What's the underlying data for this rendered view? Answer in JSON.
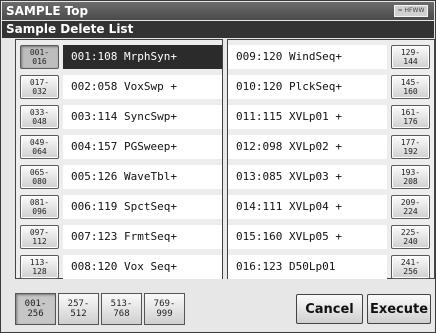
{
  "window": {
    "title": "SAMPLE Top",
    "title_icon": "≈ HFWW"
  },
  "screen": {
    "title": "Sample Delete List"
  },
  "left": {
    "range_buttons": [
      [
        "001-",
        "016"
      ],
      [
        "017-",
        "032"
      ],
      [
        "033-",
        "048"
      ],
      [
        "049-",
        "064"
      ],
      [
        "065-",
        "080"
      ],
      [
        "081-",
        "096"
      ],
      [
        "097-",
        "112"
      ],
      [
        "113-",
        "128"
      ]
    ],
    "samples": [
      "001:108 MrphSyn+",
      "002:058 VoxSwp +",
      "003:114 SyncSwp+",
      "004:157 PGSweep+",
      "005:126 WaveTbl+",
      "006:119 SpctSeq+",
      "007:123 FrmtSeq+",
      "008:120 Vox Seq+"
    ]
  },
  "right": {
    "range_buttons": [
      [
        "129-",
        "144"
      ],
      [
        "145-",
        "160"
      ],
      [
        "161-",
        "176"
      ],
      [
        "177-",
        "192"
      ],
      [
        "193-",
        "208"
      ],
      [
        "209-",
        "224"
      ],
      [
        "225-",
        "240"
      ],
      [
        "241-",
        "256"
      ]
    ],
    "samples": [
      "009:120 WindSeq+",
      "010:120 PlckSeq+",
      "011:115 XVLp01 +",
      "012:098 XVLp02 +",
      "013:085 XVLp03 +",
      "014:111 XVLp04 +",
      "015:160 XVLp05 +",
      "016:123 D50Lp01"
    ]
  },
  "tabs": [
    [
      "001-",
      "256"
    ],
    [
      "257-",
      "512"
    ],
    [
      "513-",
      "768"
    ],
    [
      "769-",
      "999"
    ]
  ],
  "buttons": {
    "cancel": "Cancel",
    "execute": "Execute"
  }
}
